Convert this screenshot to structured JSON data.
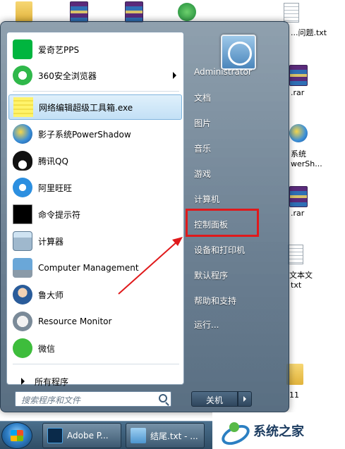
{
  "desktop": {
    "labels": {
      "top_txt": "...问题.txt",
      "rar1": ".rar",
      "shadow_line1": "系统",
      "shadow_line2": "werSh...",
      "rar2": ".rar",
      "txt2_line1": "文本文",
      "txt2_line2": "txt",
      "folder_num": "11"
    }
  },
  "start_menu": {
    "programs": [
      {
        "label": "爱奇艺PPS",
        "icon": "iqiyi-icon"
      },
      {
        "label": "360安全浏览器",
        "icon": "360-browser-icon",
        "has_submenu": true
      },
      {
        "label": "网络编辑超级工具箱.exe",
        "icon": "exe-icon",
        "highlighted": true
      },
      {
        "label": "影子系统PowerShadow",
        "icon": "powershadow-icon"
      },
      {
        "label": "腾讯QQ",
        "icon": "qq-icon"
      },
      {
        "label": "阿里旺旺",
        "icon": "aliwangwang-icon"
      },
      {
        "label": "命令提示符",
        "icon": "cmd-icon"
      },
      {
        "label": "计算器",
        "icon": "calculator-icon"
      },
      {
        "label": "Computer Management",
        "icon": "computer-management-icon"
      },
      {
        "label": "鲁大师",
        "icon": "ludashi-icon"
      },
      {
        "label": "Resource Monitor",
        "icon": "resource-monitor-icon"
      },
      {
        "label": "微信",
        "icon": "wechat-icon"
      }
    ],
    "all_programs": "所有程序",
    "search_placeholder": "搜索程序和文件",
    "right_items": [
      "Administrator",
      "文档",
      "图片",
      "音乐",
      "游戏",
      "计算机",
      "控制面板",
      "设备和打印机",
      "默认程序",
      "帮助和支持",
      "运行..."
    ],
    "shutdown_label": "关机"
  },
  "taskbar": {
    "buttons": [
      {
        "label": "Adobe P...",
        "icon": "photoshop-icon"
      },
      {
        "label": "结尾.txt - ...",
        "icon": "notepad-icon"
      }
    ]
  },
  "watermark": {
    "text": "系统之家"
  },
  "colors": {
    "annotation_red": "#e0191b",
    "highlight_blue": "#c3e0f6"
  }
}
